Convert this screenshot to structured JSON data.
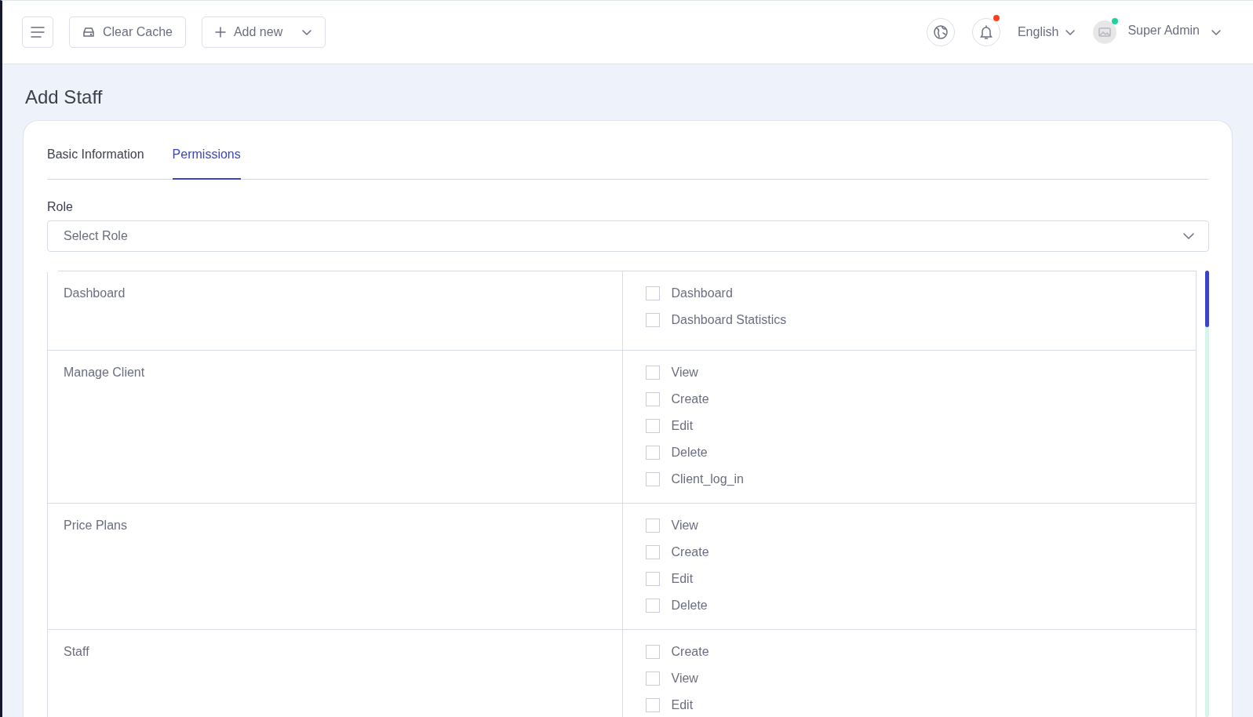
{
  "header": {
    "clear_cache": "Clear Cache",
    "add_new": "Add new",
    "language": "English",
    "user": "Super Admin",
    "notification_dot": true,
    "online": true
  },
  "page_title": "Add Staff",
  "tabs": [
    {
      "label": "Basic Information",
      "selected": false
    },
    {
      "label": "Permissions",
      "selected": true
    }
  ],
  "role": {
    "label": "Role",
    "placeholder": "Select Role"
  },
  "permissions": [
    {
      "group": "Dashboard",
      "items": [
        {
          "label": "Dashboard",
          "checked": false
        },
        {
          "label": "Dashboard Statistics",
          "checked": false
        }
      ]
    },
    {
      "group": "Manage Client",
      "items": [
        {
          "label": "View",
          "checked": false
        },
        {
          "label": "Create",
          "checked": false
        },
        {
          "label": "Edit",
          "checked": false
        },
        {
          "label": "Delete",
          "checked": false
        },
        {
          "label": "Client_log_in",
          "checked": false
        }
      ]
    },
    {
      "group": "Price Plans",
      "items": [
        {
          "label": "View",
          "checked": false
        },
        {
          "label": "Create",
          "checked": false
        },
        {
          "label": "Edit",
          "checked": false
        },
        {
          "label": "Delete",
          "checked": false
        }
      ]
    },
    {
      "group": "Staff",
      "items": [
        {
          "label": "Create",
          "checked": false
        },
        {
          "label": "View",
          "checked": false
        },
        {
          "label": "Edit",
          "checked": false
        }
      ]
    }
  ]
}
